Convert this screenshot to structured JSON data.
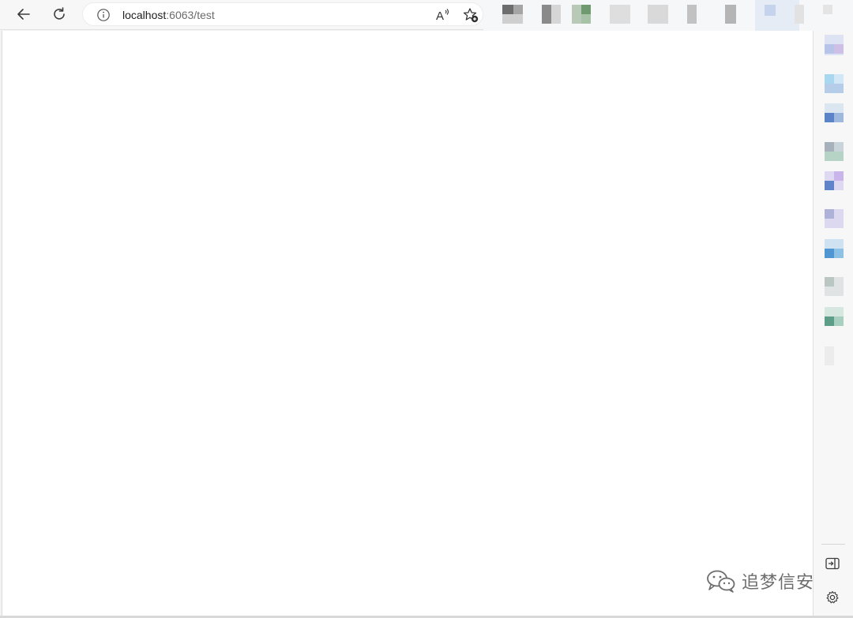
{
  "browser": {
    "url_host": "localhost",
    "url_rest": ":6063/test",
    "read_aloud_glyph": "A",
    "icons": [
      "back-arrow-icon",
      "reload-icon",
      "site-info-icon",
      "read-aloud-icon",
      "add-favorite-icon",
      "sidebar-hide-icon",
      "settings-icon"
    ]
  },
  "watermark": {
    "text": "追梦信安",
    "icon": "wechat-icon"
  },
  "colors": {
    "toolbar_bg": "#f7f7f7",
    "page_bg": "#ffffff",
    "icon_color": "#3b3b3b"
  }
}
